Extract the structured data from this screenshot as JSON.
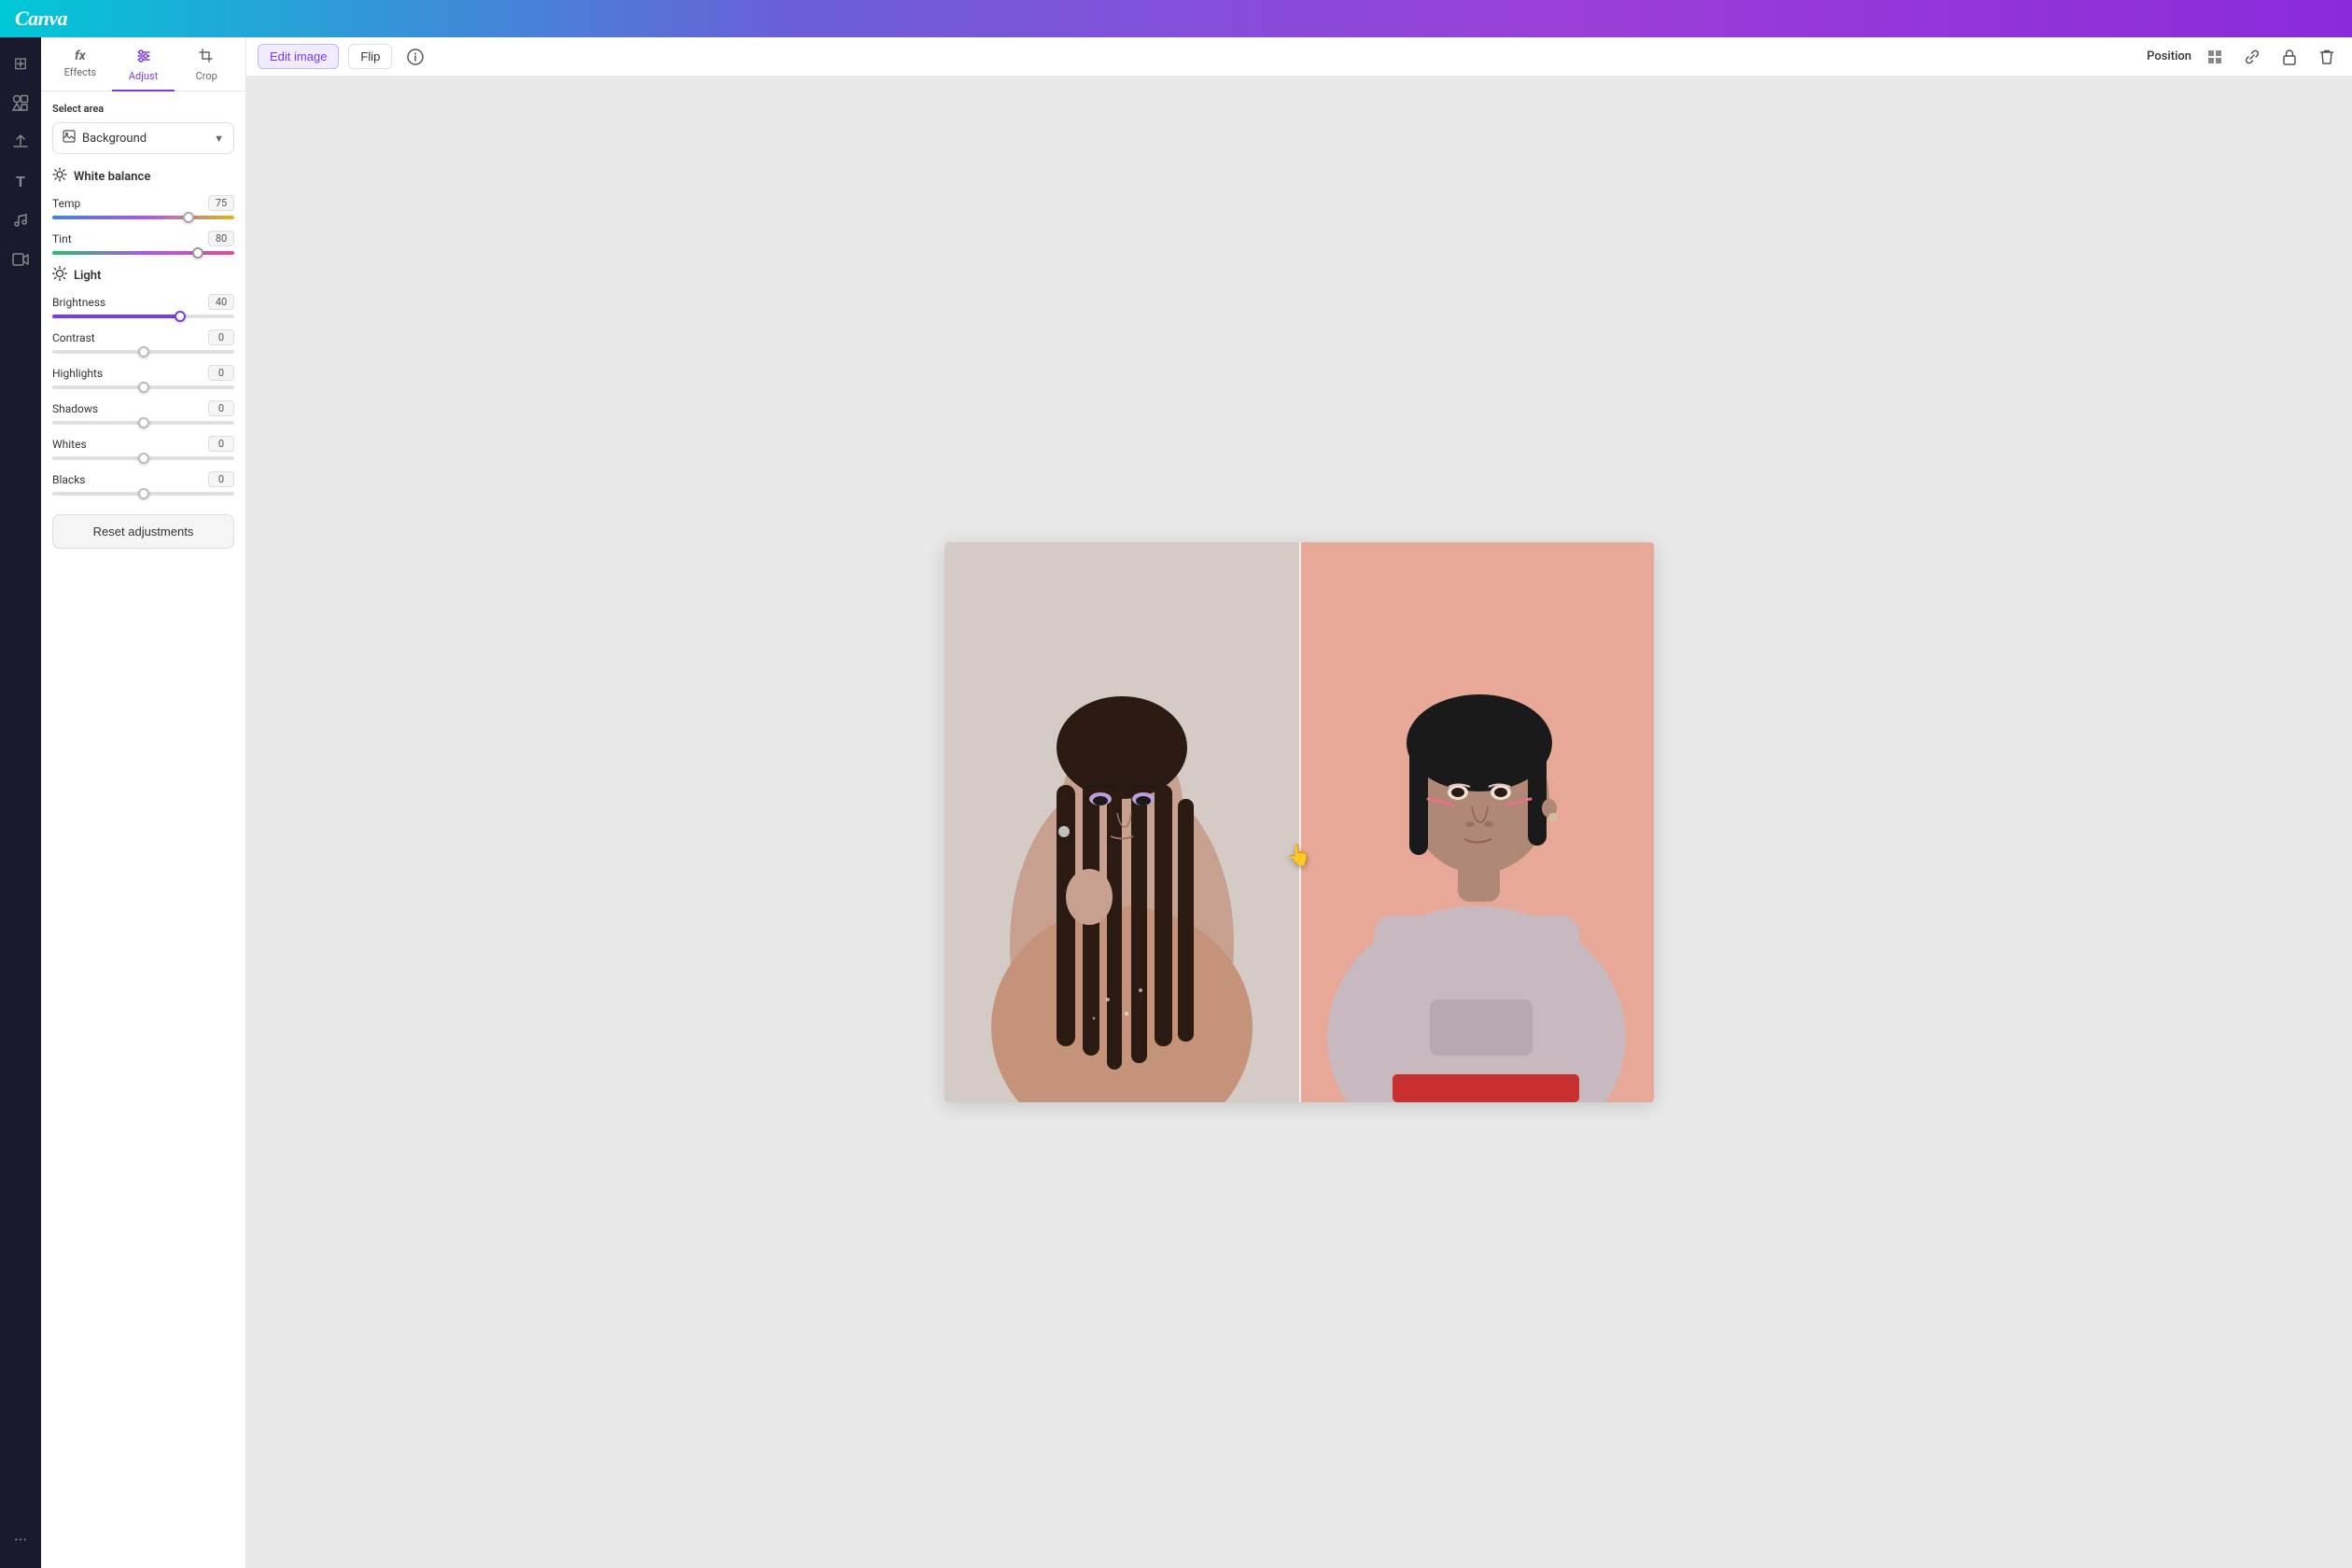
{
  "app": {
    "logo": "Canva"
  },
  "header": {
    "position_label": "Position",
    "edit_image_label": "Edit image",
    "flip_label": "Flip"
  },
  "left_sidebar": {
    "icons": [
      {
        "name": "home-icon",
        "symbol": "⊞",
        "label": "Home"
      },
      {
        "name": "elements-icon",
        "symbol": "◈",
        "label": "Elements"
      },
      {
        "name": "upload-icon",
        "symbol": "↑",
        "label": "Upload"
      },
      {
        "name": "text-icon",
        "symbol": "T",
        "label": "Text"
      },
      {
        "name": "music-icon",
        "symbol": "♪",
        "label": "Music"
      },
      {
        "name": "video-icon",
        "symbol": "▶",
        "label": "Video"
      }
    ],
    "more_label": "..."
  },
  "panel": {
    "tabs": [
      {
        "id": "effects",
        "label": "Effects",
        "icon": "fx"
      },
      {
        "id": "adjust",
        "label": "Adjust",
        "icon": "≈",
        "active": true
      },
      {
        "id": "crop",
        "label": "Crop",
        "icon": "⊡"
      }
    ],
    "select_area": {
      "label": "Select area",
      "value": "Background",
      "dropdown_icon": "▼"
    },
    "white_balance": {
      "title": "White balance",
      "icon": "○",
      "sliders": [
        {
          "id": "temp",
          "label": "Temp",
          "value": 75,
          "min": 0,
          "max": 100,
          "percent": 75
        },
        {
          "id": "tint",
          "label": "Tint",
          "value": 80,
          "min": 0,
          "max": 100,
          "percent": 80
        }
      ]
    },
    "light": {
      "title": "Light",
      "icon": "☀",
      "sliders": [
        {
          "id": "brightness",
          "label": "Brightness",
          "value": 40,
          "min": -100,
          "max": 100,
          "percent": 70
        },
        {
          "id": "contrast",
          "label": "Contrast",
          "value": 0,
          "min": -100,
          "max": 100,
          "percent": 50
        },
        {
          "id": "highlights",
          "label": "Highlights",
          "value": 0,
          "min": -100,
          "max": 100,
          "percent": 50
        },
        {
          "id": "shadows",
          "label": "Shadows",
          "value": 0,
          "min": -100,
          "max": 100,
          "percent": 50
        },
        {
          "id": "whites",
          "label": "Whites",
          "value": 0,
          "min": -100,
          "max": 100,
          "percent": 50
        },
        {
          "id": "blacks",
          "label": "Blacks",
          "value": 0,
          "min": -100,
          "max": 100,
          "percent": 50
        }
      ]
    },
    "reset_button_label": "Reset adjustments"
  }
}
